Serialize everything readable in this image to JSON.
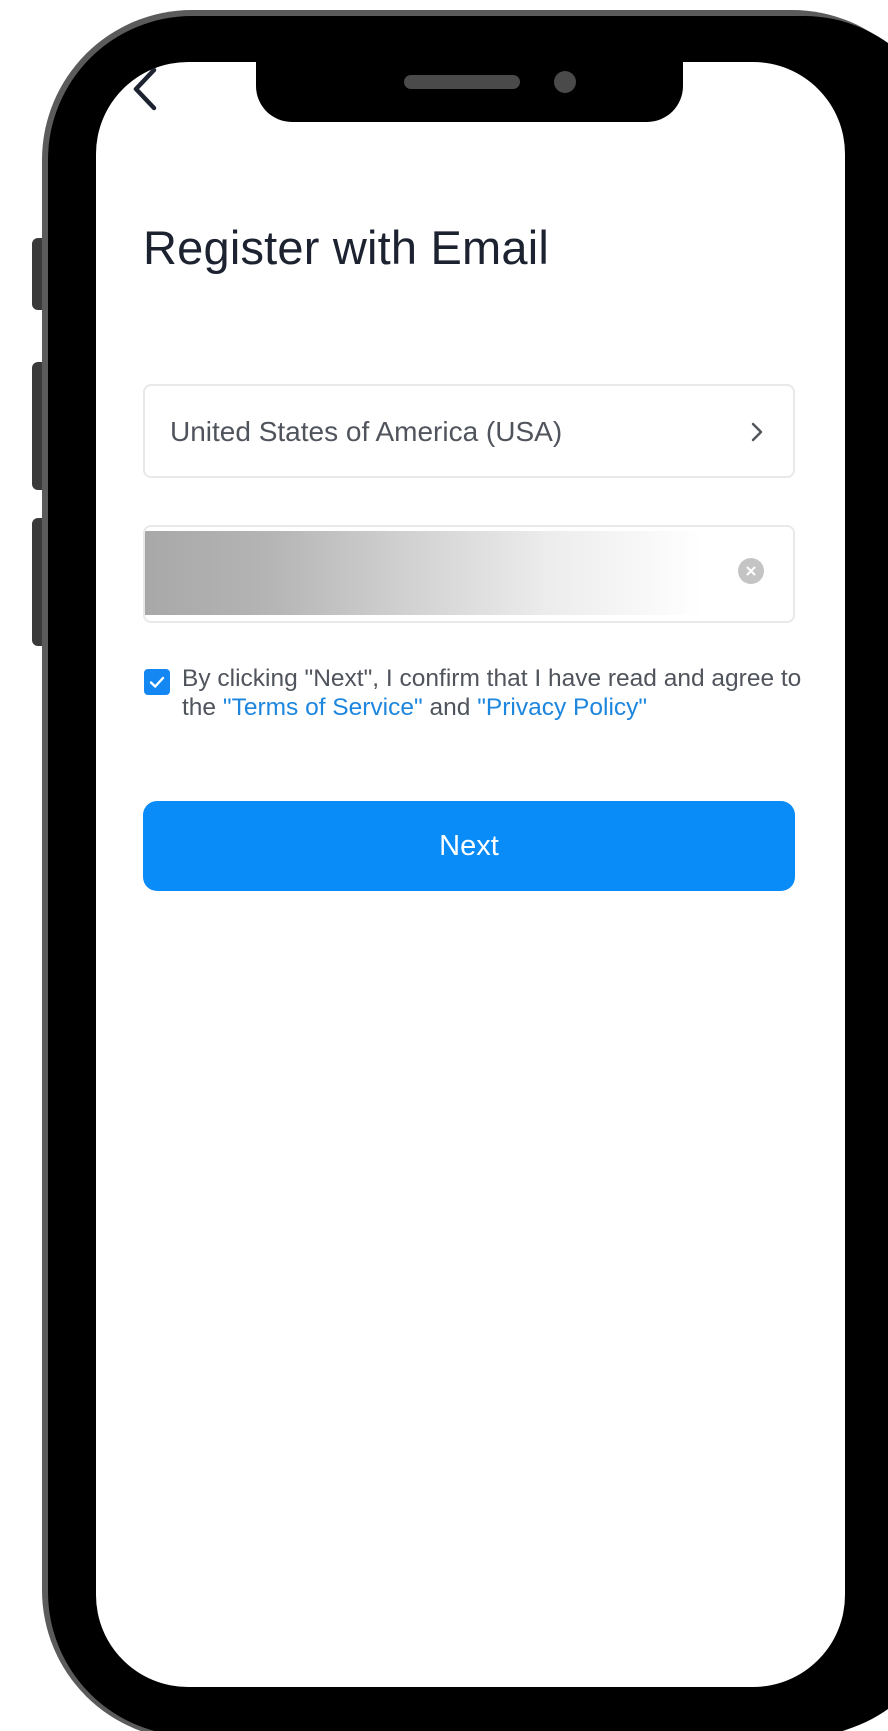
{
  "screen": {
    "title": "Register with Email",
    "back_icon": "chevron-left-icon"
  },
  "country_selector": {
    "value": "United States of America (USA)",
    "icon": "chevron-right-icon"
  },
  "email_field": {
    "value": "",
    "clear_icon": "clear-x-icon"
  },
  "consent": {
    "checked": true,
    "text_prefix": "By clicking \"Next\", I confirm that I have read and agree to the",
    "terms_link": "\"Terms of Service\"",
    "conjunction": "and",
    "privacy_link": "\"Privacy Policy\""
  },
  "actions": {
    "next_label": "Next"
  },
  "colors": {
    "accent": "#0a8cf8",
    "link": "#1d86de",
    "title_text": "#1c2230",
    "body_text": "#50545c"
  }
}
